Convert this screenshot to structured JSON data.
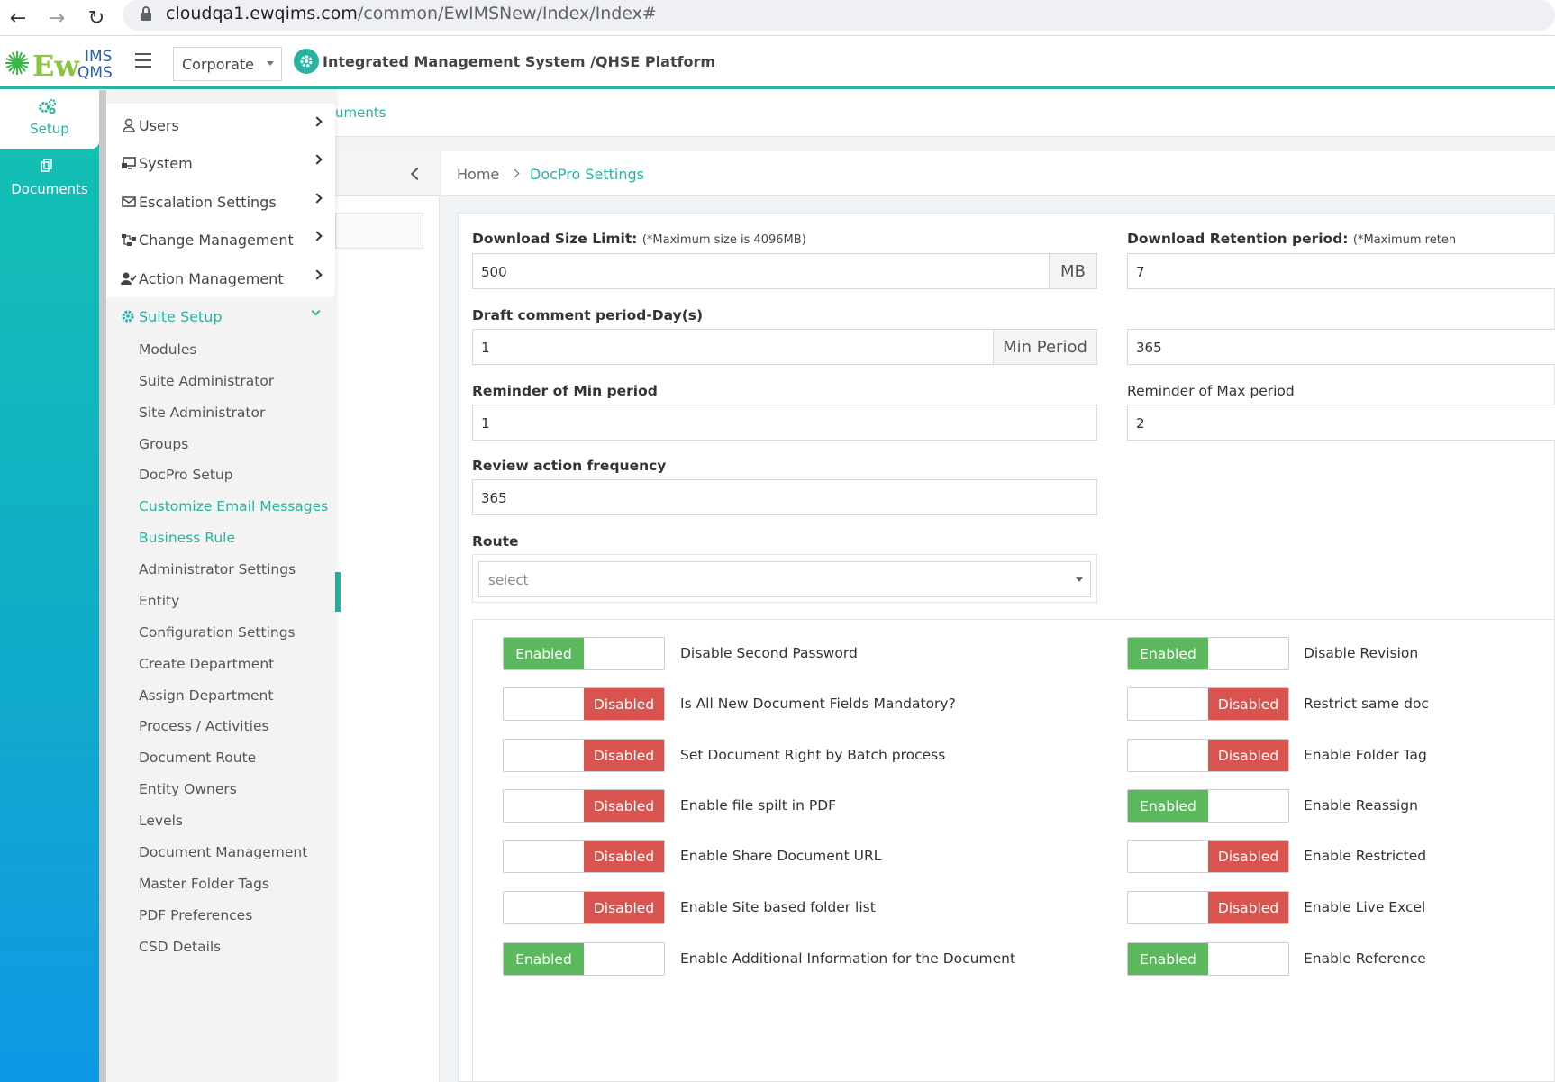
{
  "browser": {
    "url_host": "cloudqa1.ewqims.com",
    "url_path": "/common/EwIMSNew/Index/Index#"
  },
  "header": {
    "logo_text": "EwQIMS",
    "entity_selector": "Corporate",
    "platform_title": "Integrated Management System /QHSE Platform"
  },
  "rail": {
    "setup_label": "Setup",
    "documents_label": "Documents"
  },
  "menu": {
    "items": [
      "Users",
      "System",
      "Escalation Settings",
      "Change Management",
      "Action Management"
    ],
    "expanded": "Suite Setup",
    "sub_items": [
      "Modules",
      "Suite Administrator",
      "Site Administrator",
      "Groups",
      "DocPro Setup",
      "Customize Email Messages",
      "Business Rule",
      "Administrator Settings",
      "Entity",
      "Configuration Settings",
      "Create Department",
      "Assign Department",
      "Process / Activities",
      "Document Route",
      "Entity Owners",
      "Levels",
      "Document Management",
      "Master Folder Tags",
      "PDF Preferences",
      "CSD Details"
    ]
  },
  "under_tab": "uments",
  "breadcrumb": {
    "home": "Home",
    "current": "DocPro Settings"
  },
  "form": {
    "download_size_label": "Download Size Limit:",
    "download_size_note": "(*Maximum size is 4096MB)",
    "download_size_value": "500",
    "download_size_unit": "MB",
    "retention_label": "Download Retention period:",
    "retention_note": "(*Maximum reten",
    "retention_value": "7",
    "draft_label": "Draft comment period-Day(s)",
    "draft_min_value": "1",
    "draft_min_unit": "Min Period",
    "draft_max_value": "365",
    "reminder_min_label": "Reminder of Min period",
    "reminder_min_value": "1",
    "reminder_max_label": "Reminder of Max period",
    "reminder_max_value": "2",
    "review_label": "Review action frequency",
    "review_value": "365",
    "route_label": "Route",
    "route_placeholder": "select"
  },
  "toggle_text": {
    "enabled": "Enabled",
    "disabled": "Disabled"
  },
  "toggles_left": [
    {
      "label": "Disable Second Password",
      "enabled": true
    },
    {
      "label": "Is All New Document Fields Mandatory?",
      "enabled": false
    },
    {
      "label": "Set Document Right by Batch process",
      "enabled": false
    },
    {
      "label": "Enable file spilt in PDF",
      "enabled": false
    },
    {
      "label": "Enable Share Document URL",
      "enabled": false
    },
    {
      "label": "Enable Site based folder list",
      "enabled": false
    },
    {
      "label": "Enable Additional Information for the Document",
      "enabled": true
    }
  ],
  "toggles_right": [
    {
      "label": "Disable Revision",
      "enabled": true
    },
    {
      "label": "Restrict same doc",
      "enabled": false
    },
    {
      "label": "Enable Folder Tag",
      "enabled": false
    },
    {
      "label": "Enable Reassign",
      "enabled": true
    },
    {
      "label": "Enable Restricted",
      "enabled": false
    },
    {
      "label": "Enable Live Excel",
      "enabled": false
    },
    {
      "label": "Enable Reference",
      "enabled": true
    }
  ],
  "colors": {
    "accent": "#26b3a0",
    "enabled": "#5cb85c",
    "disabled": "#d9534f"
  }
}
